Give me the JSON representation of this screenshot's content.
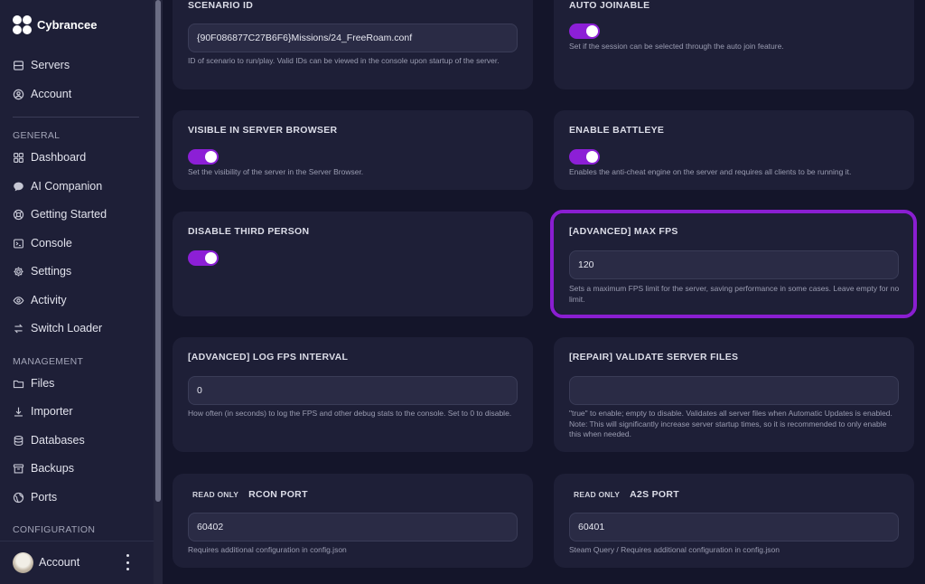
{
  "brand": {
    "name": "Cybrancee"
  },
  "nav_top": [
    {
      "label": "Servers",
      "icon": "server-icon"
    },
    {
      "label": "Account",
      "icon": "user-circle-icon"
    }
  ],
  "sections": {
    "general": "GENERAL",
    "management": "MANAGEMENT",
    "configuration": "CONFIGURATION"
  },
  "nav_general": [
    {
      "label": "Dashboard",
      "icon": "grid-icon"
    },
    {
      "label": "AI Companion",
      "icon": "chat-icon"
    },
    {
      "label": "Getting Started",
      "icon": "lifebuoy-icon"
    },
    {
      "label": "Console",
      "icon": "terminal-icon"
    },
    {
      "label": "Settings",
      "icon": "gear-icon"
    },
    {
      "label": "Activity",
      "icon": "eye-icon"
    },
    {
      "label": "Switch Loader",
      "icon": "swap-icon"
    }
  ],
  "nav_management": [
    {
      "label": "Files",
      "icon": "folder-icon"
    },
    {
      "label": "Importer",
      "icon": "download-icon"
    },
    {
      "label": "Databases",
      "icon": "database-icon"
    },
    {
      "label": "Backups",
      "icon": "archive-icon"
    },
    {
      "label": "Ports",
      "icon": "globe-icon"
    }
  ],
  "footer": {
    "account_label": "Account"
  },
  "colors": {
    "accent": "#8c1fd6",
    "highlight": "#8a1ed1",
    "card": "#1e1f37",
    "background": "#14152a"
  },
  "cards": {
    "scenario_id": {
      "title": "SCENARIO ID",
      "value": "{90F086877C27B6F6}Missions/24_FreeRoam.conf",
      "desc": "ID of scenario to run/play. Valid IDs can be viewed in the console upon startup of the server."
    },
    "auto_joinable": {
      "title": "AUTO JOINABLE",
      "enabled": true,
      "desc": "Set if the session can be selected through the auto join feature."
    },
    "visible_browser": {
      "title": "VISIBLE IN SERVER BROWSER",
      "enabled": true,
      "desc": "Set the visibility of the server in the Server Browser."
    },
    "battleye": {
      "title": "ENABLE BATTLEYE",
      "enabled": true,
      "desc": "Enables the anti-cheat engine on the server and requires all clients to be running it."
    },
    "third_person": {
      "title": "DISABLE THIRD PERSON",
      "enabled": true
    },
    "max_fps": {
      "title": "[ADVANCED] MAX FPS",
      "value": "120",
      "desc": "Sets a maximum FPS limit for the server, saving performance in some cases. Leave empty for no limit."
    },
    "log_fps": {
      "title": "[ADVANCED] LOG FPS INTERVAL",
      "value": "0",
      "desc": "How often (in seconds) to log the FPS and other debug stats to the console. Set to 0 to disable."
    },
    "validate_files": {
      "title": "[REPAIR] VALIDATE SERVER FILES",
      "value": "",
      "desc": "\"true\" to enable; empty to disable. Validates all server files when Automatic Updates is enabled. Note: This will significantly increase server startup times, so it is recommended to only enable this when needed."
    },
    "rcon_port": {
      "badge": "READ ONLY",
      "title": "RCON PORT",
      "value": "60402",
      "desc": "Requires additional configuration in config.json"
    },
    "a2s_port": {
      "badge": "READ ONLY",
      "title": "A2S PORT",
      "value": "60401",
      "desc": "Steam Query / Requires additional configuration in config.json"
    }
  }
}
